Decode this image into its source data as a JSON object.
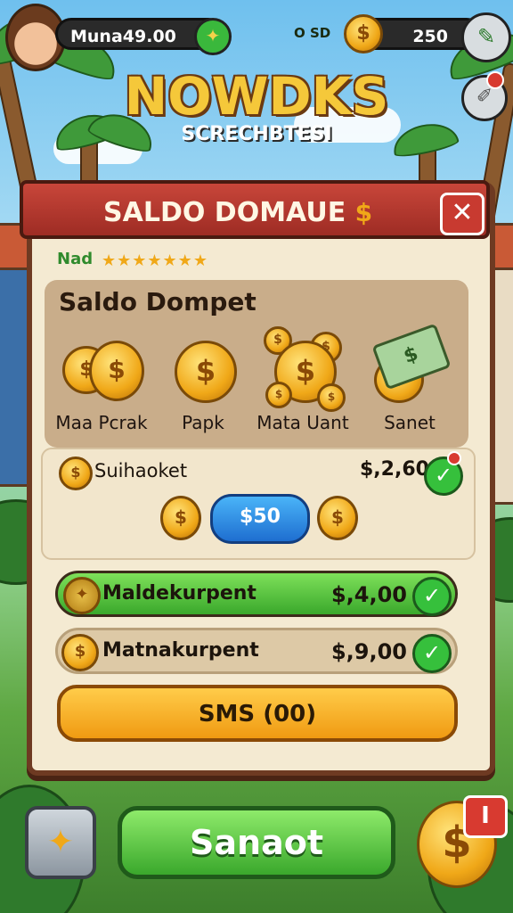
{
  "header": {
    "player_name": "Muna49.00",
    "currency_label": "O SD",
    "coin_count": "250"
  },
  "game_title": "NOWDKS",
  "game_subtitle": "SCRECHBTESI",
  "panel": {
    "title": "SALDO DOMAUE",
    "close_label": "✕",
    "rating_label": "Nad",
    "stars": "★★★★★★★",
    "wallet_title": "Saldo Dompet",
    "items": [
      {
        "label": "Maa Pcrak",
        "icon": "coin-stack-icon"
      },
      {
        "label": "Papk",
        "icon": "coin-icon"
      },
      {
        "label": "Mata Uant",
        "icon": "coins-scatter-icon"
      },
      {
        "label": "Sanet",
        "icon": "cash-stack-icon"
      }
    ],
    "sub_label": "Suihaoket",
    "sub_value": "$,2,60",
    "amount_button": "$50",
    "rows": [
      {
        "label": "Maldekurpent",
        "value": "$,4,00"
      },
      {
        "label": "Matnakurpent",
        "value": "$,9,00"
      }
    ],
    "sms_button": "SMS (00)"
  },
  "footer": {
    "main_button": "Sanaot",
    "badge": "I"
  },
  "colors": {
    "panel_header": "#b53a30",
    "panel_bg": "#f4ead2",
    "green": "#3aa82c",
    "gold": "#f0a818",
    "blue": "#1e6ed0"
  }
}
